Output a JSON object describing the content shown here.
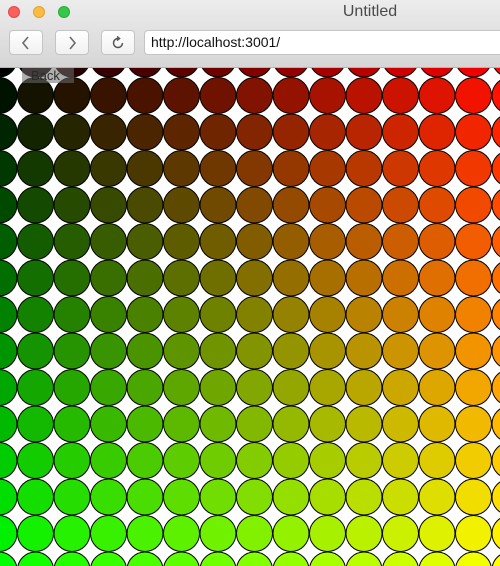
{
  "window": {
    "title": "Untitled"
  },
  "toolbar": {
    "back_icon": "chevron-left-icon",
    "forward_icon": "chevron-right-icon",
    "reload_icon": "reload-icon",
    "url": "http://localhost:3001/"
  },
  "page": {
    "back_link_label": "Back"
  },
  "colors": {
    "circle_stroke": "#000000",
    "background": "#ffffff",
    "close": "#fc605c",
    "minimize": "#fdbc40",
    "maximize": "#34c84a"
  },
  "circle_grid": {
    "description_color_rule": "red increases left-to-right, green increases top-to-bottom, blue 0",
    "columns_visible": 14,
    "rows_visible": 14
  }
}
